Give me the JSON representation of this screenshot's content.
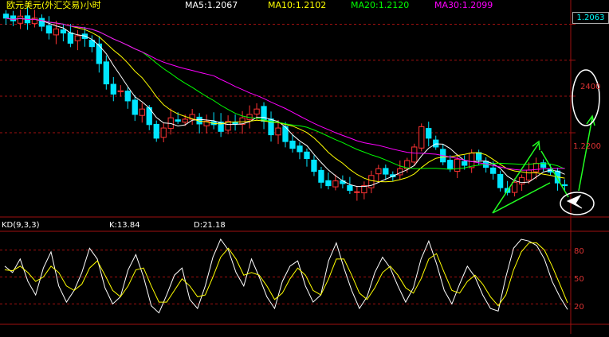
{
  "header": {
    "title": "欧元美元(外汇交易)小时",
    "ma5": "MA5:1.2067",
    "ma10": "MA10:1.2102",
    "ma20": "MA20:1.2120",
    "ma30": "MA30:1.2099"
  },
  "colors": {
    "ma5": "#ffffff",
    "ma10": "#ffff00",
    "ma20": "#00ff00",
    "ma30": "#ff00ff",
    "up_candle": "#ff3333",
    "down_candle": "#00e5ff",
    "grid": "#a01010",
    "annotation": "#22ff22"
  },
  "price_axis": {
    "current_price": "1.2063",
    "labels": [
      "2400",
      "1.2200"
    ]
  },
  "kd_panel": {
    "title": "KD(9,3,3)",
    "k_label": "K:13.84",
    "d_label": "D:21.18",
    "levels": [
      "80",
      "50",
      "20"
    ]
  },
  "chart_data": [
    {
      "type": "candlestick",
      "title": "欧元美元(外汇交易)小时",
      "series": [
        {
          "name": "MA5",
          "value": 1.2067
        },
        {
          "name": "MA10",
          "value": 1.2102
        },
        {
          "name": "MA20",
          "value": 1.212
        },
        {
          "name": "MA30",
          "value": 1.2099
        }
      ],
      "y_tick_labels": [
        "2400",
        "1.2200"
      ],
      "last_price": 1.2063,
      "ylim": [
        1.216,
        1.246
      ],
      "closes": [
        1.2452,
        1.2448,
        1.2455,
        1.2445,
        1.2452,
        1.244,
        1.243,
        1.2436,
        1.243,
        1.2415,
        1.2426,
        1.2422,
        1.241,
        1.2385,
        1.2355,
        1.234,
        1.2345,
        1.233,
        1.231,
        1.2318,
        1.2295,
        1.2275,
        1.229,
        1.2305,
        1.23,
        1.2303,
        1.231,
        1.2296,
        1.23,
        1.2295,
        1.2285,
        1.23,
        1.2296,
        1.2305,
        1.231,
        1.2318,
        1.23,
        1.228,
        1.229,
        1.227,
        1.226,
        1.2255,
        1.2245,
        1.2226,
        1.221,
        1.2205,
        1.2212,
        1.2208,
        1.2198,
        1.2196,
        1.2205,
        1.222,
        1.223,
        1.2222,
        1.2218,
        1.223,
        1.2242,
        1.2262,
        1.2292,
        1.2275,
        1.2262,
        1.224,
        1.223,
        1.2244,
        1.2235,
        1.2253,
        1.2243,
        1.2232,
        1.2223,
        1.2202,
        1.2195,
        1.221,
        1.2217,
        1.2228,
        1.2238,
        1.2232,
        1.2225,
        1.2209,
        1.2205
      ],
      "gridlines": [
        1.2443,
        1.239,
        1.2337,
        1.2283
      ]
    },
    {
      "type": "line",
      "title": "KD(9,3,3)",
      "series": [
        {
          "name": "K",
          "last": 13.84,
          "values": [
            62,
            55,
            70,
            45,
            30,
            60,
            78,
            40,
            22,
            35,
            55,
            82,
            70,
            38,
            20,
            28,
            58,
            75,
            50,
            18,
            10,
            30,
            52,
            60,
            25,
            15,
            40,
            72,
            92,
            80,
            55,
            40,
            70,
            50,
            28,
            15,
            45,
            62,
            68,
            40,
            22,
            30,
            68,
            88,
            60,
            35,
            15,
            28,
            55,
            72,
            60,
            40,
            22,
            38,
            70,
            90,
            65,
            35,
            20,
            42,
            62,
            50,
            30,
            15,
            12,
            50,
            82,
            92,
            90,
            85,
            70,
            45,
            28,
            13.84
          ]
        },
        {
          "name": "D",
          "last": 21.18,
          "values": [
            58,
            57,
            62,
            55,
            45,
            50,
            62,
            55,
            40,
            35,
            42,
            60,
            68,
            52,
            35,
            28,
            40,
            58,
            60,
            40,
            22,
            22,
            35,
            48,
            40,
            28,
            30,
            50,
            72,
            82,
            70,
            52,
            55,
            52,
            40,
            25,
            32,
            48,
            60,
            52,
            35,
            30,
            48,
            70,
            70,
            52,
            32,
            25,
            38,
            55,
            62,
            52,
            38,
            32,
            48,
            70,
            76,
            55,
            35,
            32,
            45,
            52,
            42,
            28,
            18,
            30,
            58,
            78,
            88,
            88,
            80,
            62,
            42,
            21.18
          ]
        }
      ],
      "y_tick_labels": [
        "80",
        "50",
        "20"
      ],
      "ylim": [
        0,
        100
      ]
    }
  ]
}
